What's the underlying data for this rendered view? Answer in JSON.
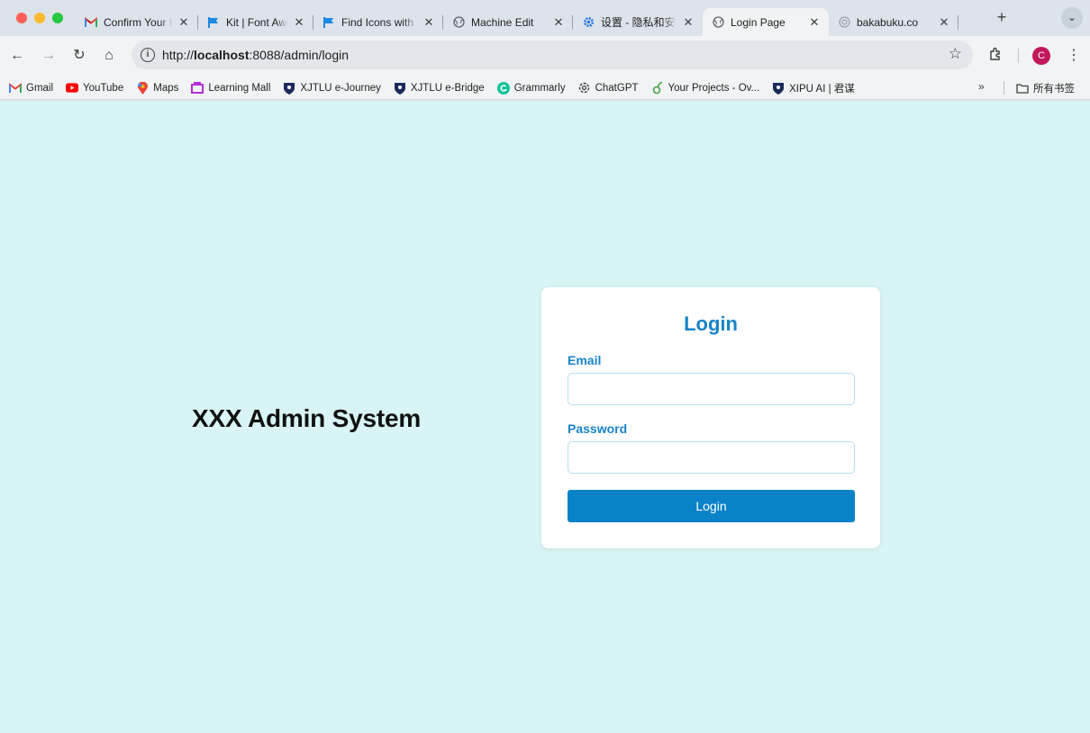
{
  "browser": {
    "tabs": [
      {
        "title": "Confirm Your F",
        "icon": "gmail-icon"
      },
      {
        "title": "Kit | Font Awes",
        "icon": "fontawesome-flag-icon"
      },
      {
        "title": "Find Icons with",
        "icon": "fontawesome-flag-icon"
      },
      {
        "title": "Machine Edit",
        "icon": "globe-icon"
      },
      {
        "title": "设置 - 隐私和安",
        "icon": "gear-icon"
      },
      {
        "title": "Login Page",
        "icon": "globe-icon",
        "active": true
      },
      {
        "title": "bakabuku.co",
        "icon": "loading-icon"
      }
    ],
    "new_tab_label": "+",
    "address": {
      "prefix": "http://",
      "host": "localhost",
      "rest": ":8088/admin/login"
    },
    "profile_initial": "C",
    "bookmarks": [
      {
        "label": "Gmail",
        "icon": "gmail-icon"
      },
      {
        "label": "YouTube",
        "icon": "youtube-icon"
      },
      {
        "label": "Maps",
        "icon": "maps-icon"
      },
      {
        "label": "Learning Mall",
        "icon": "learning-mall-icon"
      },
      {
        "label": "XJTLU e-Journey",
        "icon": "xjtlu-shield-icon"
      },
      {
        "label": "XJTLU e-Bridge",
        "icon": "xjtlu-shield-icon"
      },
      {
        "label": "Grammarly",
        "icon": "grammarly-icon"
      },
      {
        "label": "ChatGPT",
        "icon": "chatgpt-icon"
      },
      {
        "label": "Your Projects - Ov...",
        "icon": "overleaf-icon"
      },
      {
        "label": "XIPU AI | 君谋",
        "icon": "xjtlu-shield-icon"
      }
    ],
    "bookmarks_more": "»",
    "all_bookmarks_label": "所有书签"
  },
  "page": {
    "system_title": "XXX Admin System",
    "login": {
      "heading": "Login",
      "email_label": "Email",
      "email_value": "",
      "password_label": "Password",
      "password_value": "",
      "submit_label": "Login"
    }
  },
  "colors": {
    "page_background": "#d9f4f4",
    "accent": "#1784c7",
    "button": "#0a82c8"
  }
}
